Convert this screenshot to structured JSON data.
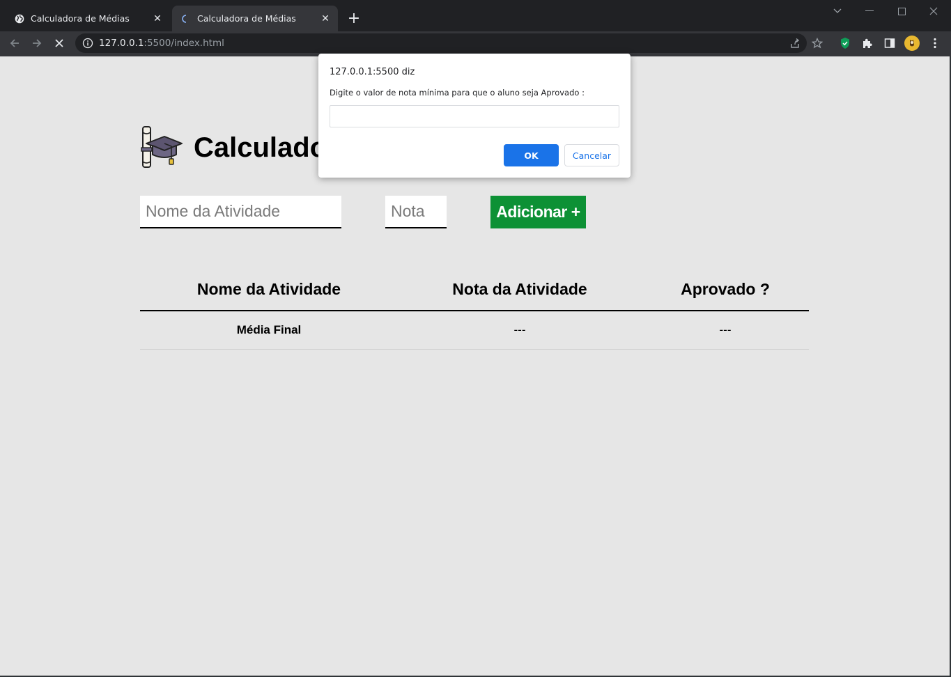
{
  "browser": {
    "tabs": [
      {
        "title": "Calculadora de Médias",
        "active": false,
        "icon": "globe-icon"
      },
      {
        "title": "Calculadora de Médias",
        "active": true,
        "icon": "loading-spinner-icon"
      }
    ],
    "new_tab": "+",
    "address": {
      "host": "127.0.0.1",
      "rest": ":5500/index.html"
    }
  },
  "page": {
    "title": "Calculadora de Médias",
    "activity_placeholder": "Nome da Atividade",
    "grade_placeholder": "Nota",
    "add_button": "Adicionar +",
    "table": {
      "headers": [
        "Nome da Atividade",
        "Nota da Atividade",
        "Aprovado ?"
      ],
      "footer": [
        "Média Final",
        "---",
        "---"
      ]
    }
  },
  "dialog": {
    "origin": "127.0.0.1:5500 diz",
    "message": "Digite o valor de nota mínima para que o aluno seja Aprovado :",
    "input_value": "",
    "ok_label": "OK",
    "cancel_label": "Cancelar"
  },
  "colors": {
    "add_button": "#0d9135",
    "dialog_ok": "#1a73e8",
    "page_background": "#e6e6e6"
  }
}
